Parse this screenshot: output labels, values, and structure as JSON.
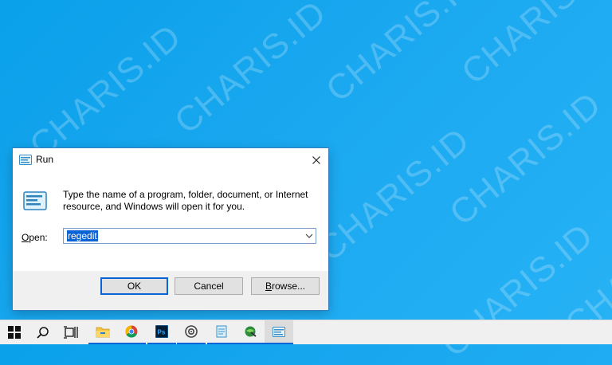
{
  "watermark": {
    "text": "CHARIS.ID"
  },
  "dialog": {
    "title": "Run",
    "description": "Type the name of a program, folder, document, or Internet resource, and Windows will open it for you.",
    "open_label_prefix": "O",
    "open_label_rest": "pen:",
    "open_value": "regedit",
    "ok_label": "OK",
    "cancel_label": "Cancel",
    "browse_label_prefix": "B",
    "browse_label_rest": "rowse..."
  },
  "taskbar": {
    "items": [
      {
        "name": "start-button",
        "icon": "windows-logo-icon"
      },
      {
        "name": "search-button",
        "icon": "search-icon"
      },
      {
        "name": "task-view-button",
        "icon": "task-view-icon"
      },
      {
        "name": "file-explorer",
        "icon": "folder-icon"
      },
      {
        "name": "chrome",
        "icon": "chrome-icon"
      },
      {
        "name": "photoshop",
        "icon": "photoshop-icon",
        "label": "Ps"
      },
      {
        "name": "media-app",
        "icon": "disc-icon"
      },
      {
        "name": "notepad-app",
        "icon": "notepad-icon"
      },
      {
        "name": "network-app",
        "icon": "globe-icon"
      },
      {
        "name": "run-app",
        "icon": "run-icon"
      }
    ]
  },
  "colors": {
    "accent": "#0a64d6",
    "desktop": "#1aa8f0"
  }
}
